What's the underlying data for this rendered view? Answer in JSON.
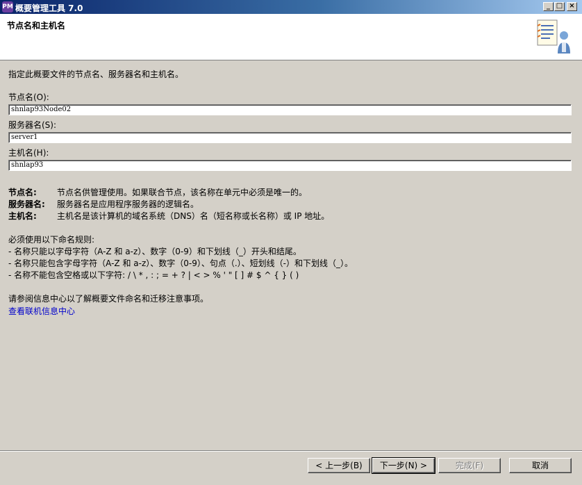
{
  "window": {
    "title": "概要管理工具 7.0",
    "icon_text": "PM",
    "controls": [
      "_",
      "□",
      "×"
    ]
  },
  "header": {
    "title": "节点名和主机名",
    "art_icon": "wizard-document-person-icon"
  },
  "intro": "指定此概要文件的节点名、服务器名和主机名。",
  "fields": {
    "node": {
      "label": "节点名(O):",
      "value": "shnlap93Node02"
    },
    "server": {
      "label": "服务器名(S):",
      "value": "server1"
    },
    "host": {
      "label": "主机名(H):",
      "value": "shnlap93"
    }
  },
  "descriptions": [
    {
      "term": "节点名:",
      "text": "节点名供管理使用。如果联合节点，该名称在单元中必须是唯一的。"
    },
    {
      "term": "服务器名:",
      "text": "服务器名是应用程序服务器的逻辑名。"
    },
    {
      "term": "主机名:",
      "text": "主机名是该计算机的域名系统（DNS）名（短名称或长名称）或 IP 地址。"
    }
  ],
  "rules": {
    "heading": "必须使用以下命名规则:",
    "items": [
      "-  名称只能以字母字符（A-Z 和 a-z）、数字（0-9）和下划线（_）开头和结尾。",
      "-  名称只能包含字母字符（A-Z 和 a-z）、数字（0-9）、句点（.）、短划线（-）和下划线（_）。",
      "-  名称不能包含空格或以下字符: / \\ * , : ; = + ? | < >  % ' \" [ ] # $ ^ { } ( )"
    ]
  },
  "reference": "请参阅信息中心以了解概要文件命名和迁移注意事项。",
  "link": "查看联机信息中心",
  "buttons": {
    "back": "< 上一步(B)",
    "next": "下一步(N) >",
    "finish": "完成(F)",
    "cancel": "取消"
  },
  "colors": {
    "titlebar_start": "#0a246a",
    "titlebar_end": "#a6caf0",
    "dialog_bg": "#d4d0c8",
    "link": "#0000cc"
  }
}
